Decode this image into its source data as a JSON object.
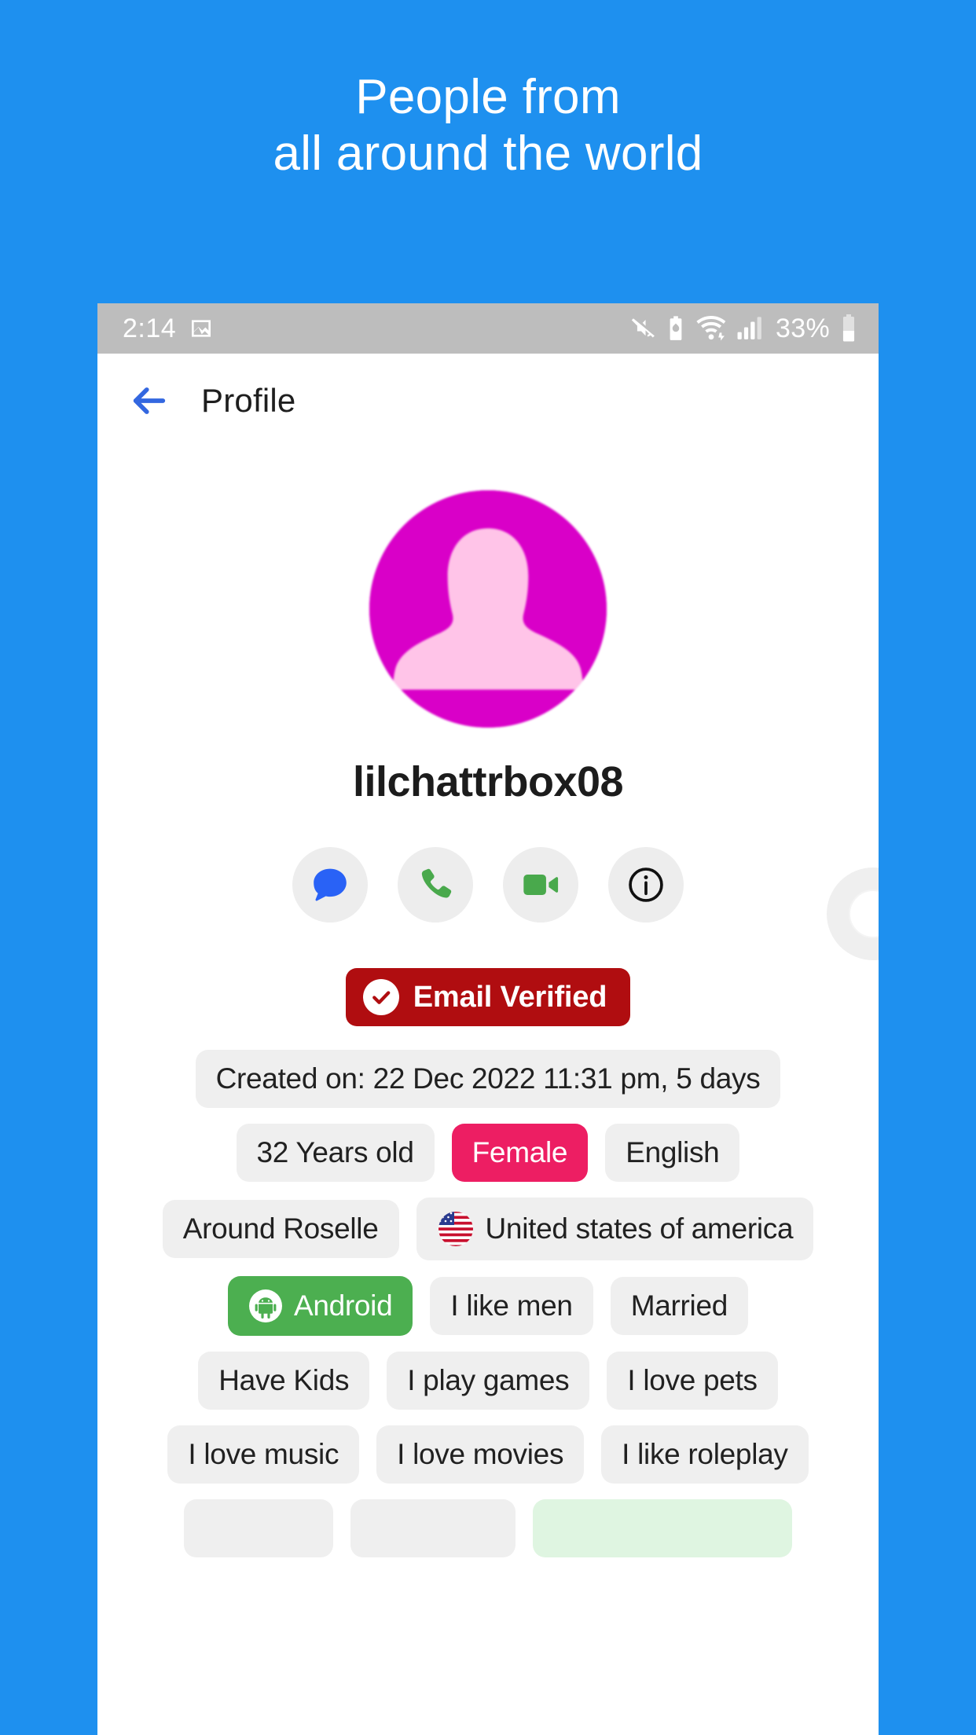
{
  "promo": {
    "headline": "People from\nall around the world",
    "background_color": "#1E90EF",
    "text_color": "#FFFFFF"
  },
  "status_bar": {
    "time": "2:14",
    "battery_percent": "33%",
    "icons": [
      "image-icon",
      "mute-icon",
      "battery-saver-icon",
      "wifi-icon",
      "signal-icon",
      "battery-icon"
    ],
    "background_color": "#BDBDBD"
  },
  "app_bar": {
    "back_icon": "back-arrow-icon",
    "back_color": "#3367E0",
    "title": "Profile"
  },
  "profile": {
    "avatar_icon": "person-placeholder-avatar",
    "avatar_bg": "#D900C8",
    "avatar_fg": "#FFC4E8",
    "username": "lilchattrbox08",
    "side_button_icon": "ring-icon"
  },
  "actions": [
    {
      "name": "message-button",
      "icon": "chat-bubble-icon",
      "color": "#2962F6"
    },
    {
      "name": "call-button",
      "icon": "phone-icon",
      "color": "#49A94C"
    },
    {
      "name": "video-button",
      "icon": "video-camera-icon",
      "color": "#49A94C"
    },
    {
      "name": "info-button",
      "icon": "info-circle-icon",
      "color": "#111111"
    }
  ],
  "verified": {
    "label": "Email Verified",
    "icon": "check-circle-icon",
    "background_color": "#B00D10",
    "text_color": "#FFFFFF"
  },
  "chip_rows": [
    [
      {
        "label": "Created on: 22 Dec 2022 11:31 pm, 5 days",
        "style": "default"
      }
    ],
    [
      {
        "label": "32 Years old",
        "style": "default"
      },
      {
        "label": "Female",
        "style": "pink"
      },
      {
        "label": "English",
        "style": "default"
      }
    ],
    [
      {
        "label": "Around Roselle",
        "style": "default"
      },
      {
        "label": "United states of america",
        "style": "default",
        "icon": "us-flag-icon"
      }
    ],
    [
      {
        "label": "Android",
        "style": "green",
        "icon": "android-robot-icon"
      },
      {
        "label": "I like men",
        "style": "default"
      },
      {
        "label": "Married",
        "style": "default"
      }
    ],
    [
      {
        "label": "Have Kids",
        "style": "default"
      },
      {
        "label": "I play games",
        "style": "default"
      },
      {
        "label": "I love pets",
        "style": "default"
      }
    ],
    [
      {
        "label": "I love music",
        "style": "default"
      },
      {
        "label": "I love movies",
        "style": "default"
      },
      {
        "label": "I like roleplay",
        "style": "default"
      }
    ],
    [
      {
        "label": "",
        "style": "default"
      },
      {
        "label": "",
        "style": "default"
      },
      {
        "label": "",
        "style": "mint"
      }
    ]
  ]
}
